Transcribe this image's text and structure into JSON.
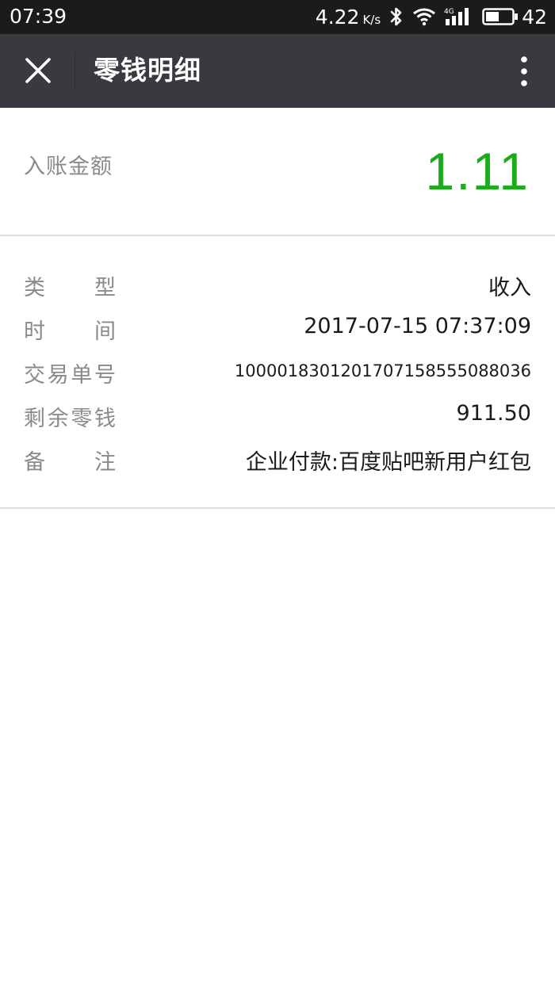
{
  "status_bar": {
    "time": "07:39",
    "speed": "4.22",
    "speed_unit": "K/s",
    "network": "4G",
    "battery": "42",
    "icons": [
      "bluetooth-icon",
      "wifi-icon",
      "signal-4g-icon",
      "battery-icon"
    ]
  },
  "header": {
    "title": "零钱明细",
    "close_icon": "close-icon",
    "more_icon": "more-vertical-icon",
    "background": "#393a3f"
  },
  "amount": {
    "label": "入账金额",
    "value": "1.11",
    "color": "#1aad19"
  },
  "details": [
    {
      "label_chars": [
        "类",
        "型"
      ],
      "value": "收入"
    },
    {
      "label_chars": [
        "时",
        "间"
      ],
      "value": "2017-07-15 07:37:09"
    },
    {
      "label_chars": [
        "交",
        "易",
        "单",
        "号"
      ],
      "value": "100001830120170715855508803​6"
    },
    {
      "label_chars": [
        "剩",
        "余",
        "零",
        "钱"
      ],
      "value": "911.50"
    },
    {
      "label_chars": [
        "备",
        "注"
      ],
      "value": "企业付款:百度贴吧新用户红包"
    }
  ]
}
